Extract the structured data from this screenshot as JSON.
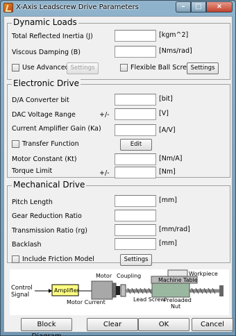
{
  "window": {
    "title": "X-Axis Leadscrew Drive Parameters",
    "min": "–",
    "max": "□",
    "close": "×"
  },
  "dynamic": {
    "title": "Dynamic Loads",
    "inertia": {
      "label": "Total Reflected Inertia (J)",
      "unit": "[kgm^2]"
    },
    "damping": {
      "label": "Viscous Damping (B)",
      "unit": "[Nms/rad]"
    },
    "use_advanced": "Use Advanced",
    "settings1": "Settings",
    "flexible": "Flexible Ball Screw",
    "settings2": "Settings"
  },
  "electronic": {
    "title": "Electronic Drive",
    "da_bit": {
      "label": "D/A Converter bit",
      "unit": "[bit]"
    },
    "dac_range": {
      "label": "DAC Voltage Range",
      "prefix": "+/-",
      "unit": "[V]"
    },
    "amp_gain": {
      "label": "Current Amplifier Gain (Ka)",
      "unit": "[A/V]"
    },
    "transfer": "Transfer Function",
    "edit": "Edit",
    "motor_const": {
      "label": "Motor Constant (Kt)",
      "unit": "[Nm/A]"
    },
    "torque": {
      "label": "Torque Limit",
      "prefix": "+/-",
      "unit": "[Nm]"
    }
  },
  "mechanical": {
    "title": "Mechanical Drive",
    "pitch": {
      "label": "Pitch Length",
      "unit": "[mm]"
    },
    "gear": {
      "label": "Gear Reduction Ratio"
    },
    "transmission": {
      "label": "Transmission Ratio (rg)",
      "unit": "[mm/rad]"
    },
    "backlash": {
      "label": "Backlash",
      "unit": "[mm]"
    },
    "friction": "Include Friction Model",
    "settings": "Settings"
  },
  "diagram": {
    "control_signal_1": "Control",
    "control_signal_2": "Signal",
    "amplifier": "Amplifier",
    "motor_current": "Motor Current",
    "motor": "Motor",
    "coupling": "Coupling",
    "lead_screw": "Lead Screw",
    "workpiece": "Workpiece",
    "machine_table": "Machine Table",
    "preloaded_1": "Preloaded",
    "preloaded_2": "Nut"
  },
  "buttons": {
    "block": "Block Diagram",
    "clear": "Clear",
    "ok": "OK",
    "cancel": "Cancel"
  }
}
